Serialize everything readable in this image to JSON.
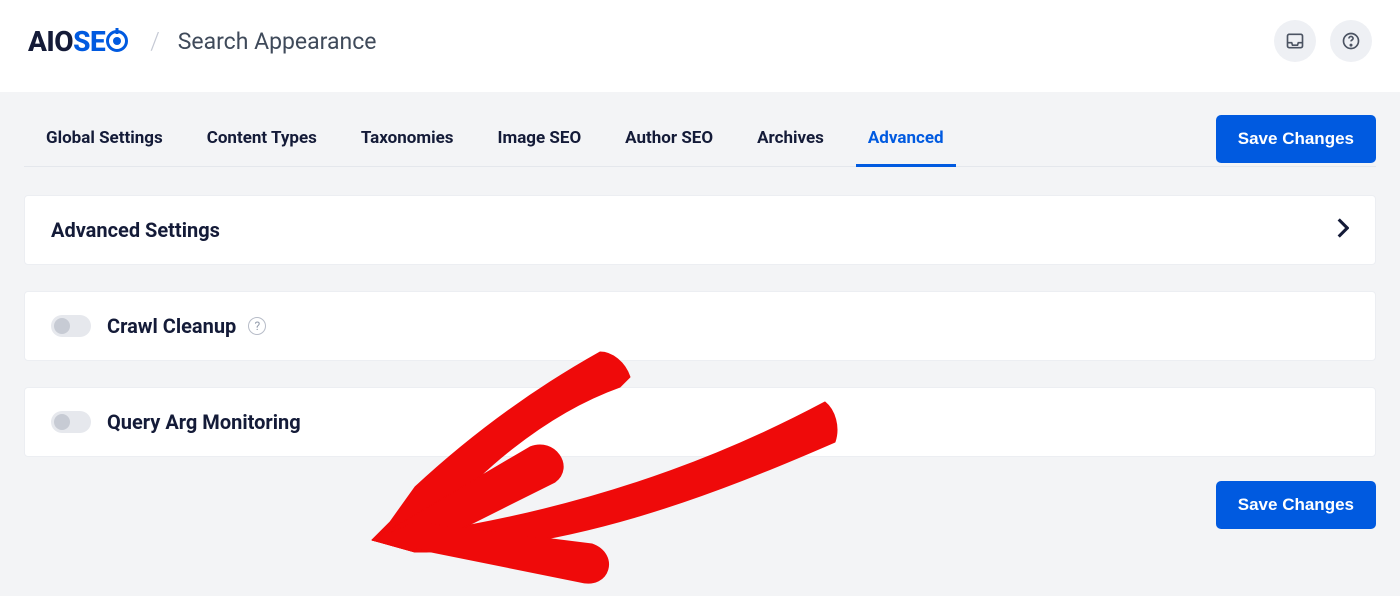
{
  "header": {
    "logo_part1": "AIO",
    "logo_part2": "SE",
    "page_title": "Search Appearance"
  },
  "tabs": [
    {
      "label": "Global Settings",
      "active": false
    },
    {
      "label": "Content Types",
      "active": false
    },
    {
      "label": "Taxonomies",
      "active": false
    },
    {
      "label": "Image SEO",
      "active": false
    },
    {
      "label": "Author SEO",
      "active": false
    },
    {
      "label": "Archives",
      "active": false
    },
    {
      "label": "Advanced",
      "active": true
    }
  ],
  "buttons": {
    "save_top": "Save Changes",
    "save_bottom": "Save Changes"
  },
  "panels": {
    "advanced_settings": "Advanced Settings",
    "crawl_cleanup": "Crawl Cleanup",
    "query_arg_monitoring": "Query Arg Monitoring"
  },
  "help_tooltip": "?"
}
